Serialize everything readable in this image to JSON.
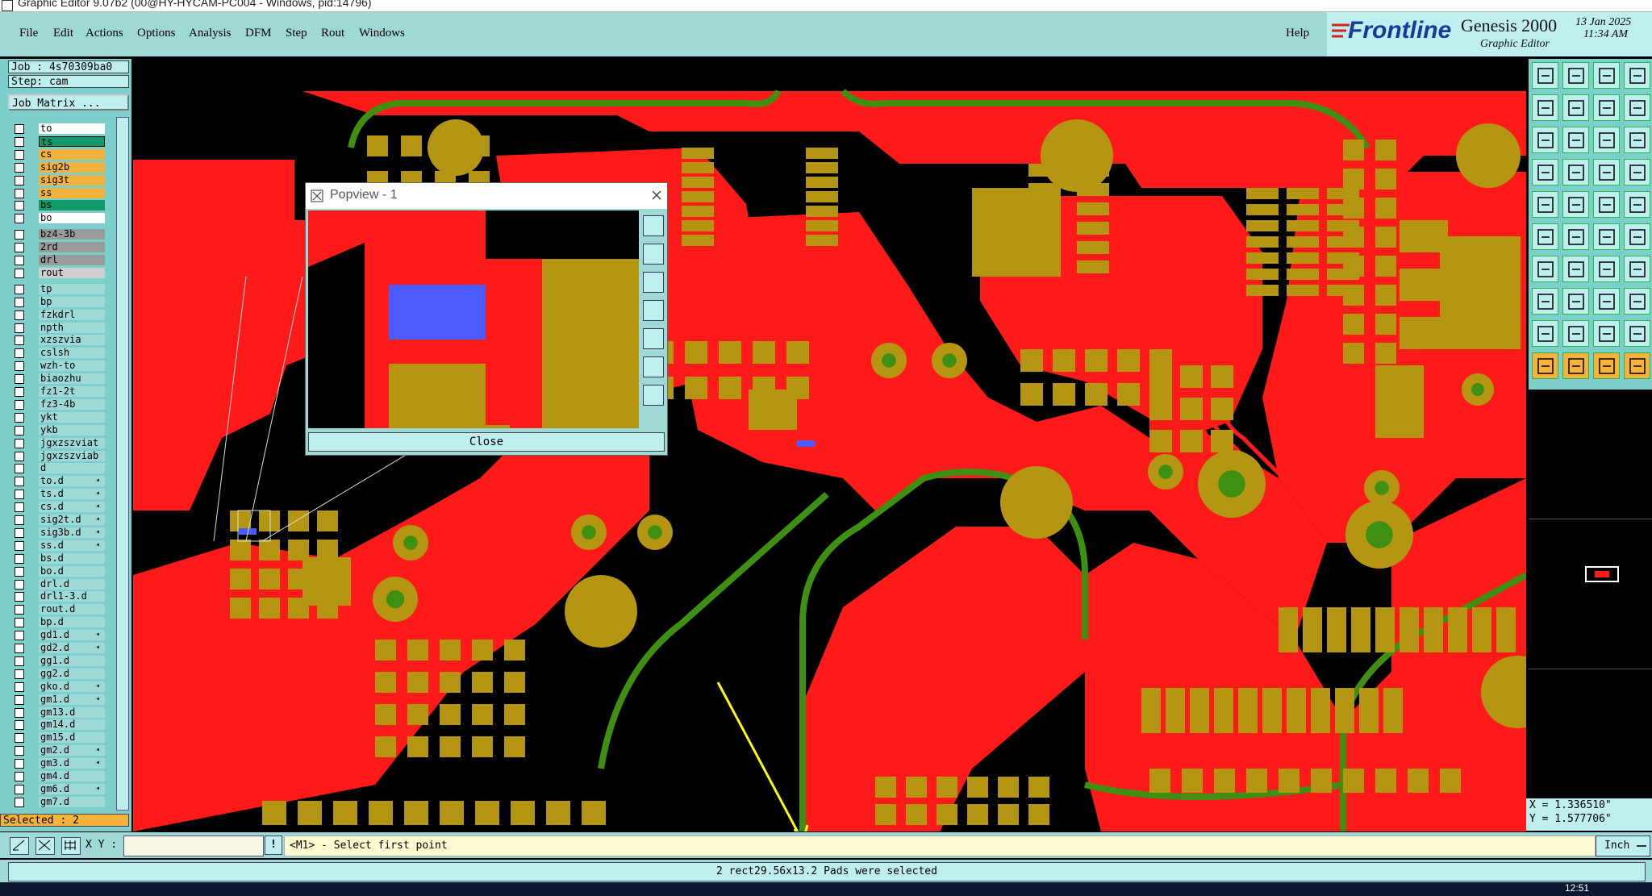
{
  "window": {
    "title": "Graphic Editor 9.07b2 (00@HY-HYCAM-PC004 - Windows, pid:14796)"
  },
  "menu": {
    "items": [
      "File",
      "Edit",
      "Actions",
      "Options",
      "Analysis",
      "DFM",
      "Step",
      "Rout",
      "Windows"
    ],
    "help": "Help"
  },
  "brand": {
    "logo": "Frontline",
    "product": "Genesis 2000",
    "module": "Graphic Editor",
    "date": "13 Jan 2025",
    "time": "11:34 AM"
  },
  "left_panel": {
    "job": "Job : 4s70309ba0",
    "step": "Step: cam",
    "job_matrix": "Job Matrix ...",
    "selected": "Selected : 2",
    "layers": [
      {
        "name": "to",
        "color": "#ffffff"
      },
      {
        "name": "ts",
        "color": "#119966",
        "active": true
      },
      {
        "name": "cs",
        "color": "#f3b43f"
      },
      {
        "name": "sig2b",
        "color": "#f3b43f"
      },
      {
        "name": "sig3t",
        "color": "#f3b43f"
      },
      {
        "name": "ss",
        "color": "#f3b43f"
      },
      {
        "name": "bs",
        "color": "#119966"
      },
      {
        "name": "bo",
        "color": "#ffffff"
      },
      {
        "name": "bz4-3b",
        "color": "#9a9a9a"
      },
      {
        "name": "2rd",
        "color": "#9a9a9a"
      },
      {
        "name": "drl",
        "color": "#9a9a9a"
      },
      {
        "name": "rout",
        "color": "#cfcfcf"
      },
      {
        "name": "tp",
        "color": "#9fd9d6"
      },
      {
        "name": "bp",
        "color": "#9fd9d6"
      },
      {
        "name": "fzkdrl",
        "color": "#9fd9d6"
      },
      {
        "name": "npth",
        "color": "#9fd9d6"
      },
      {
        "name": "xzszvia",
        "color": "#9fd9d6"
      },
      {
        "name": "cslsh",
        "color": "#9fd9d6"
      },
      {
        "name": "wzh-to",
        "color": "#9fd9d6"
      },
      {
        "name": "biaozhu",
        "color": "#9fd9d6"
      },
      {
        "name": "fz1-2t",
        "color": "#9fd9d6"
      },
      {
        "name": "fz3-4b",
        "color": "#9fd9d6"
      },
      {
        "name": "ykt",
        "color": "#9fd9d6"
      },
      {
        "name": "ykb",
        "color": "#9fd9d6"
      },
      {
        "name": "jgxzszviat",
        "color": "#9fd9d6"
      },
      {
        "name": "jgxzszviab",
        "color": "#9fd9d6"
      },
      {
        "name": "d",
        "color": "#9fd9d6"
      },
      {
        "name": "to.d",
        "color": "#9fd9d6",
        "arrow": true
      },
      {
        "name": "ts.d",
        "color": "#9fd9d6",
        "arrow": true
      },
      {
        "name": "cs.d",
        "color": "#9fd9d6",
        "arrow": true
      },
      {
        "name": "sig2t.d",
        "color": "#9fd9d6",
        "arrow": true
      },
      {
        "name": "sig3b.d",
        "color": "#9fd9d6",
        "arrow": true
      },
      {
        "name": "ss.d",
        "color": "#9fd9d6",
        "arrow": true
      },
      {
        "name": "bs.d",
        "color": "#9fd9d6"
      },
      {
        "name": "bo.d",
        "color": "#9fd9d6"
      },
      {
        "name": "drl.d",
        "color": "#9fd9d6"
      },
      {
        "name": "drl1-3.d",
        "color": "#9fd9d6"
      },
      {
        "name": "rout.d",
        "color": "#9fd9d6"
      },
      {
        "name": "bp.d",
        "color": "#9fd9d6"
      },
      {
        "name": "gd1.d",
        "color": "#9fd9d6",
        "arrow": true
      },
      {
        "name": "gd2.d",
        "color": "#9fd9d6",
        "arrow": true
      },
      {
        "name": "gg1.d",
        "color": "#9fd9d6"
      },
      {
        "name": "gg2.d",
        "color": "#9fd9d6"
      },
      {
        "name": "gko.d",
        "color": "#9fd9d6",
        "arrow": true
      },
      {
        "name": "gm1.d",
        "color": "#9fd9d6",
        "arrow": true
      },
      {
        "name": "gm13.d",
        "color": "#9fd9d6"
      },
      {
        "name": "gm14.d",
        "color": "#9fd9d6"
      },
      {
        "name": "gm15.d",
        "color": "#9fd9d6"
      },
      {
        "name": "gm2.d",
        "color": "#9fd9d6",
        "arrow": true
      },
      {
        "name": "gm3.d",
        "color": "#9fd9d6",
        "arrow": true
      },
      {
        "name": "gm4.d",
        "color": "#9fd9d6"
      },
      {
        "name": "gm6.d",
        "color": "#9fd9d6",
        "arrow": true
      },
      {
        "name": "gm7.d",
        "color": "#9fd9d6"
      }
    ]
  },
  "popview": {
    "title": "Popview - 1",
    "close": "Close"
  },
  "coords": {
    "x": "X = 1.336510\"",
    "y": "Y = 1.577706\""
  },
  "command_bar": {
    "xy_label": "X Y :",
    "xy_value": "",
    "prompt": "<M1> - Select first point",
    "units": "Inch"
  },
  "status": {
    "message": "2 rect29.56x13.2 Pads were selected"
  },
  "taskbar": {
    "clock": "12:51"
  },
  "colors": {
    "copper": "#ff1a1a",
    "pad": "#b59612",
    "trace": "#3f8f12",
    "highlight": "#4a5cff",
    "panel": "#9fd9d6"
  }
}
